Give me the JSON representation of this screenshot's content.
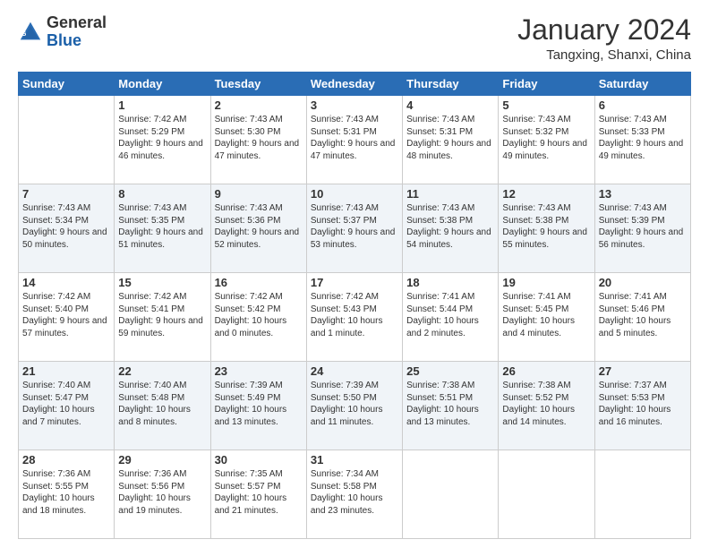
{
  "header": {
    "logo_general": "General",
    "logo_blue": "Blue",
    "month_year": "January 2024",
    "location": "Tangxing, Shanxi, China"
  },
  "days_of_week": [
    "Sunday",
    "Monday",
    "Tuesday",
    "Wednesday",
    "Thursday",
    "Friday",
    "Saturday"
  ],
  "weeks": [
    [
      {
        "day": "",
        "sunrise": "",
        "sunset": "",
        "daylight": ""
      },
      {
        "day": "1",
        "sunrise": "Sunrise: 7:42 AM",
        "sunset": "Sunset: 5:29 PM",
        "daylight": "Daylight: 9 hours and 46 minutes."
      },
      {
        "day": "2",
        "sunrise": "Sunrise: 7:43 AM",
        "sunset": "Sunset: 5:30 PM",
        "daylight": "Daylight: 9 hours and 47 minutes."
      },
      {
        "day": "3",
        "sunrise": "Sunrise: 7:43 AM",
        "sunset": "Sunset: 5:31 PM",
        "daylight": "Daylight: 9 hours and 47 minutes."
      },
      {
        "day": "4",
        "sunrise": "Sunrise: 7:43 AM",
        "sunset": "Sunset: 5:31 PM",
        "daylight": "Daylight: 9 hours and 48 minutes."
      },
      {
        "day": "5",
        "sunrise": "Sunrise: 7:43 AM",
        "sunset": "Sunset: 5:32 PM",
        "daylight": "Daylight: 9 hours and 49 minutes."
      },
      {
        "day": "6",
        "sunrise": "Sunrise: 7:43 AM",
        "sunset": "Sunset: 5:33 PM",
        "daylight": "Daylight: 9 hours and 49 minutes."
      }
    ],
    [
      {
        "day": "7",
        "sunrise": "Sunrise: 7:43 AM",
        "sunset": "Sunset: 5:34 PM",
        "daylight": "Daylight: 9 hours and 50 minutes."
      },
      {
        "day": "8",
        "sunrise": "Sunrise: 7:43 AM",
        "sunset": "Sunset: 5:35 PM",
        "daylight": "Daylight: 9 hours and 51 minutes."
      },
      {
        "day": "9",
        "sunrise": "Sunrise: 7:43 AM",
        "sunset": "Sunset: 5:36 PM",
        "daylight": "Daylight: 9 hours and 52 minutes."
      },
      {
        "day": "10",
        "sunrise": "Sunrise: 7:43 AM",
        "sunset": "Sunset: 5:37 PM",
        "daylight": "Daylight: 9 hours and 53 minutes."
      },
      {
        "day": "11",
        "sunrise": "Sunrise: 7:43 AM",
        "sunset": "Sunset: 5:38 PM",
        "daylight": "Daylight: 9 hours and 54 minutes."
      },
      {
        "day": "12",
        "sunrise": "Sunrise: 7:43 AM",
        "sunset": "Sunset: 5:38 PM",
        "daylight": "Daylight: 9 hours and 55 minutes."
      },
      {
        "day": "13",
        "sunrise": "Sunrise: 7:43 AM",
        "sunset": "Sunset: 5:39 PM",
        "daylight": "Daylight: 9 hours and 56 minutes."
      }
    ],
    [
      {
        "day": "14",
        "sunrise": "Sunrise: 7:42 AM",
        "sunset": "Sunset: 5:40 PM",
        "daylight": "Daylight: 9 hours and 57 minutes."
      },
      {
        "day": "15",
        "sunrise": "Sunrise: 7:42 AM",
        "sunset": "Sunset: 5:41 PM",
        "daylight": "Daylight: 9 hours and 59 minutes."
      },
      {
        "day": "16",
        "sunrise": "Sunrise: 7:42 AM",
        "sunset": "Sunset: 5:42 PM",
        "daylight": "Daylight: 10 hours and 0 minutes."
      },
      {
        "day": "17",
        "sunrise": "Sunrise: 7:42 AM",
        "sunset": "Sunset: 5:43 PM",
        "daylight": "Daylight: 10 hours and 1 minute."
      },
      {
        "day": "18",
        "sunrise": "Sunrise: 7:41 AM",
        "sunset": "Sunset: 5:44 PM",
        "daylight": "Daylight: 10 hours and 2 minutes."
      },
      {
        "day": "19",
        "sunrise": "Sunrise: 7:41 AM",
        "sunset": "Sunset: 5:45 PM",
        "daylight": "Daylight: 10 hours and 4 minutes."
      },
      {
        "day": "20",
        "sunrise": "Sunrise: 7:41 AM",
        "sunset": "Sunset: 5:46 PM",
        "daylight": "Daylight: 10 hours and 5 minutes."
      }
    ],
    [
      {
        "day": "21",
        "sunrise": "Sunrise: 7:40 AM",
        "sunset": "Sunset: 5:47 PM",
        "daylight": "Daylight: 10 hours and 7 minutes."
      },
      {
        "day": "22",
        "sunrise": "Sunrise: 7:40 AM",
        "sunset": "Sunset: 5:48 PM",
        "daylight": "Daylight: 10 hours and 8 minutes."
      },
      {
        "day": "23",
        "sunrise": "Sunrise: 7:39 AM",
        "sunset": "Sunset: 5:49 PM",
        "daylight": "Daylight: 10 hours and 13 minutes."
      },
      {
        "day": "24",
        "sunrise": "Sunrise: 7:39 AM",
        "sunset": "Sunset: 5:50 PM",
        "daylight": "Daylight: 10 hours and 11 minutes."
      },
      {
        "day": "25",
        "sunrise": "Sunrise: 7:38 AM",
        "sunset": "Sunset: 5:51 PM",
        "daylight": "Daylight: 10 hours and 13 minutes."
      },
      {
        "day": "26",
        "sunrise": "Sunrise: 7:38 AM",
        "sunset": "Sunset: 5:52 PM",
        "daylight": "Daylight: 10 hours and 14 minutes."
      },
      {
        "day": "27",
        "sunrise": "Sunrise: 7:37 AM",
        "sunset": "Sunset: 5:53 PM",
        "daylight": "Daylight: 10 hours and 16 minutes."
      }
    ],
    [
      {
        "day": "28",
        "sunrise": "Sunrise: 7:36 AM",
        "sunset": "Sunset: 5:55 PM",
        "daylight": "Daylight: 10 hours and 18 minutes."
      },
      {
        "day": "29",
        "sunrise": "Sunrise: 7:36 AM",
        "sunset": "Sunset: 5:56 PM",
        "daylight": "Daylight: 10 hours and 19 minutes."
      },
      {
        "day": "30",
        "sunrise": "Sunrise: 7:35 AM",
        "sunset": "Sunset: 5:57 PM",
        "daylight": "Daylight: 10 hours and 21 minutes."
      },
      {
        "day": "31",
        "sunrise": "Sunrise: 7:34 AM",
        "sunset": "Sunset: 5:58 PM",
        "daylight": "Daylight: 10 hours and 23 minutes."
      },
      {
        "day": "",
        "sunrise": "",
        "sunset": "",
        "daylight": ""
      },
      {
        "day": "",
        "sunrise": "",
        "sunset": "",
        "daylight": ""
      },
      {
        "day": "",
        "sunrise": "",
        "sunset": "",
        "daylight": ""
      }
    ]
  ]
}
